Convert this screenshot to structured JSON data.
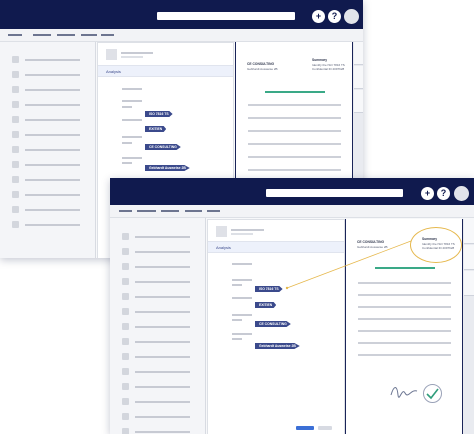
{
  "colors": {
    "topbar": "#101a4e",
    "tag": "#3b4a8c",
    "accent_green": "#3aa987",
    "highlight": "#e6b84d"
  },
  "toolbar": {
    "add_label": "+",
    "help_label": "?"
  },
  "analysis_tab_label": "Analysis",
  "tags": [
    "ISO 7816 TS",
    "EXITIEN",
    "CE CONSULTING",
    "Gebhardt Ausweise 2B"
  ],
  "doc": {
    "sender": "CE CONSULTING",
    "sender_sub": "Gebhardt Ausweise 2B",
    "summary_title": "Summary",
    "summary_line1": "Identify the ISO 7816 TS",
    "summary_line2": "Confidential ID 2097628"
  },
  "icons": [
    "plus-icon",
    "help-icon",
    "avatar-icon",
    "signature-icon",
    "checkmark-icon"
  ]
}
